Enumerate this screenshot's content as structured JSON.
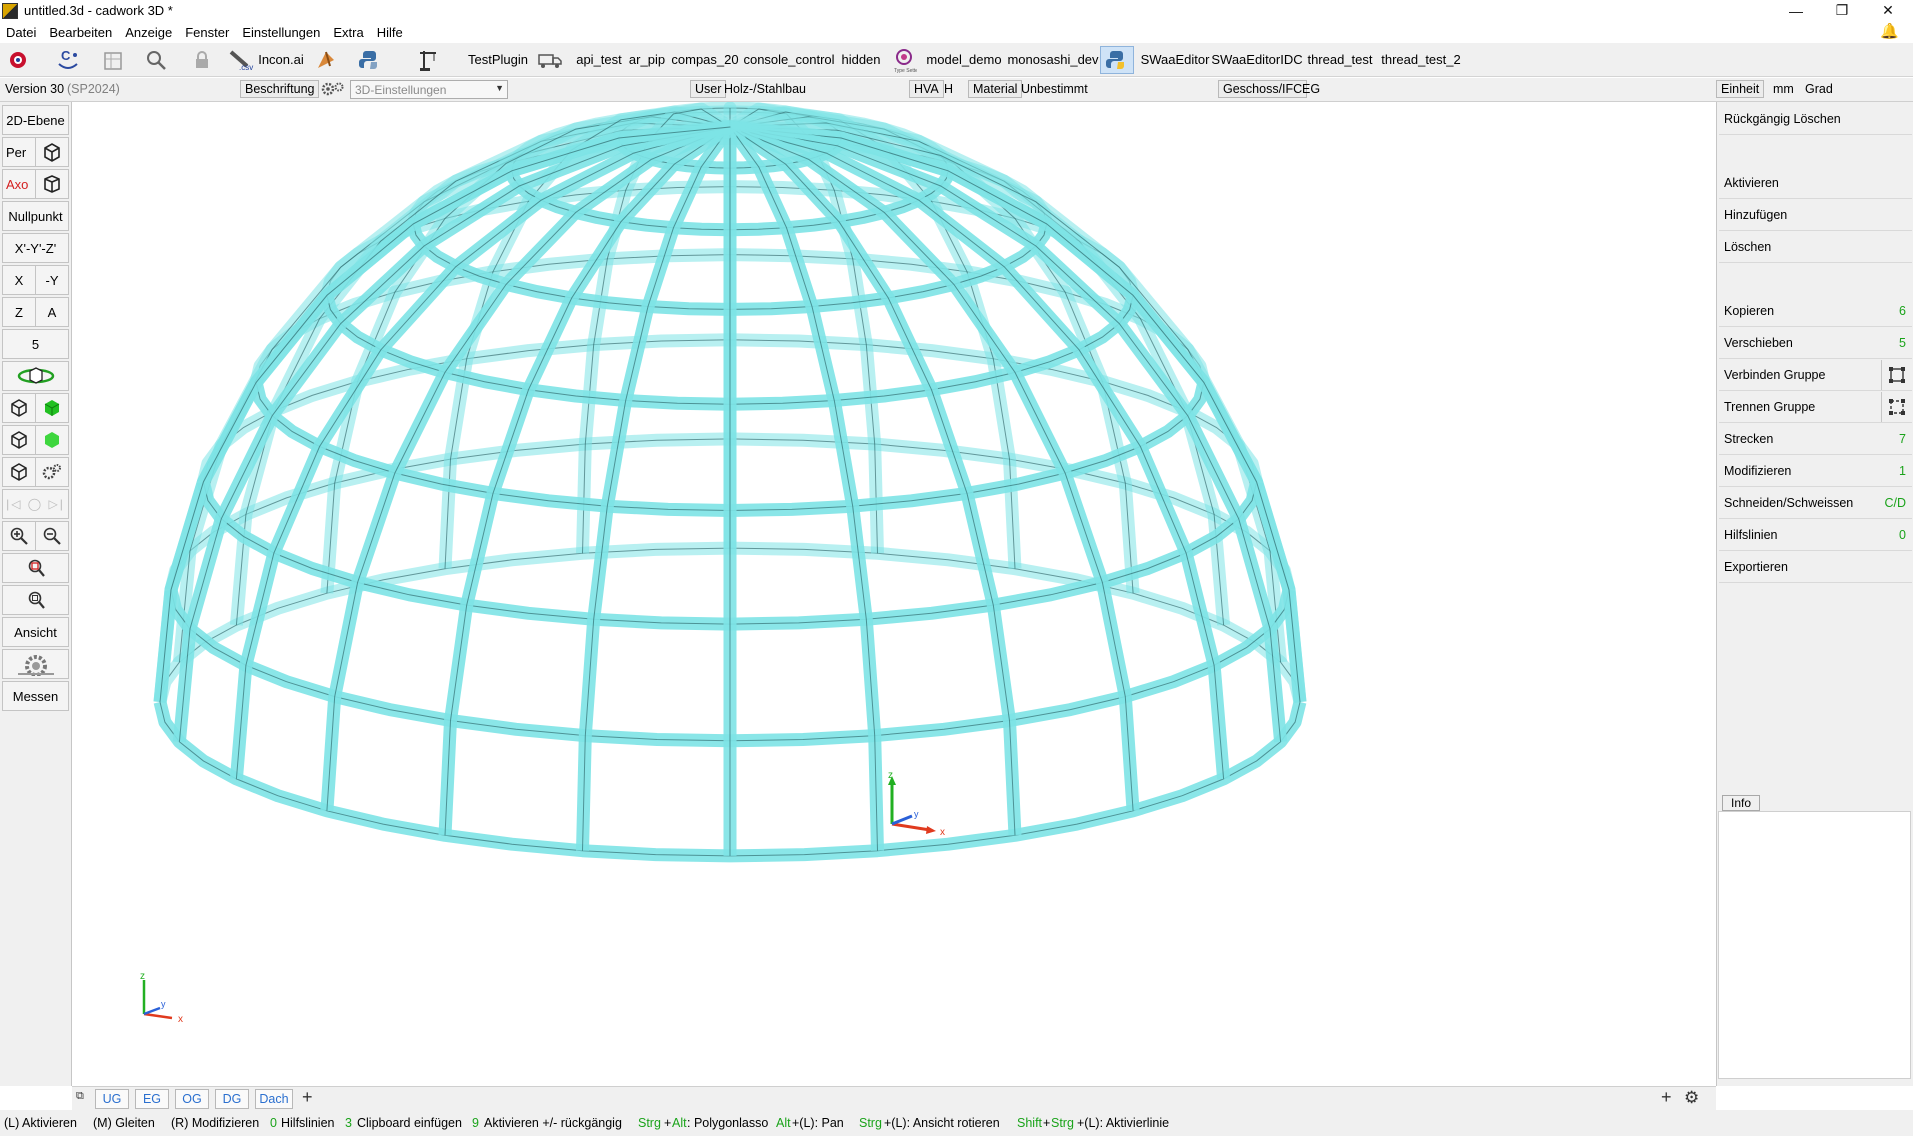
{
  "window": {
    "title": "untitled.3d - cadwork 3D *"
  },
  "menu": [
    "Datei",
    "Bearbeiten",
    "Anzeige",
    "Fenster",
    "Einstellungen",
    "Extra",
    "Hilfe"
  ],
  "toolbar": {
    "incon": "Incon.ai",
    "testplugin": "TestPlugin",
    "plugins": [
      "api_test",
      "ar_pip",
      "compas_20",
      "console_control",
      "hidden"
    ],
    "model_demo": "model_demo",
    "monosashi_dev": "monosashi_dev",
    "swaa_editor": "SWaaEditor",
    "swaa_editor_idc": "SWaaEditorIDC",
    "thread_test": "thread_test",
    "thread_test_2": "thread_test_2"
  },
  "infobar": {
    "version": "Version 30",
    "sp": "(SP2024)",
    "beschriftung": "Beschriftung",
    "settings3d": "3D-Einstellungen",
    "user_label": "User",
    "user_value": "Holz-/Stahlbau",
    "hva_label": "HVA",
    "hva_value": "H",
    "material_label": "Material",
    "material_value": "Unbestimmt",
    "geschoss_label": "Geschoss/IFC",
    "geschoss_value": "EG",
    "einheit_label": "Einheit",
    "unit_length": "mm",
    "unit_angle": "Grad"
  },
  "left_toolbar": {
    "ebene": "2D-Ebene",
    "per": "Per",
    "axo": "Axo",
    "nullpunkt": "Nullpunkt",
    "xyz": "X'-Y'-Z'",
    "x": "X",
    "neg_y": "-Y",
    "z": "Z",
    "a": "A",
    "five": "5",
    "ansicht": "Ansicht",
    "messen": "Messen"
  },
  "right_panel": {
    "undo_delete": "Rückgängig Löschen",
    "items": [
      {
        "label": "Aktivieren",
        "shortcut": ""
      },
      {
        "label": "Hinzufügen",
        "shortcut": ""
      },
      {
        "label": "Löschen",
        "shortcut": ""
      },
      {
        "label": "Kopieren",
        "shortcut": "6"
      },
      {
        "label": "Verschieben",
        "shortcut": "5"
      },
      {
        "label": "Verbinden Gruppe",
        "shortcut": ""
      },
      {
        "label": "Trennen Gruppe",
        "shortcut": ""
      },
      {
        "label": "Strecken",
        "shortcut": "7"
      },
      {
        "label": "Modifizieren",
        "shortcut": "1"
      },
      {
        "label": "Schneiden/Schweissen",
        "shortcut": "C/D"
      },
      {
        "label": "Hilfslinien",
        "shortcut": "0"
      },
      {
        "label": "Exportieren",
        "shortcut": ""
      }
    ],
    "info_tab": "Info"
  },
  "axis": {
    "x": "x",
    "y": "y",
    "z": "z"
  },
  "floor_tabs": [
    "UG",
    "EG",
    "OG",
    "DG",
    "Dach"
  ],
  "statusline": {
    "l_key": "(L) Aktivieren",
    "m_key": "(M) Gleiten",
    "r_key": "(R) Modifizieren",
    "k0": "0",
    "k0_text": "Hilfslinien",
    "k3": "3",
    "k3_text": "Clipboard einfügen",
    "k9": "9",
    "k9_text": "Aktivieren +/- rückgängig",
    "strg_alt_1": "Strg",
    "strg_alt_plus": "+",
    "strg_alt_2": "Alt",
    "strg_alt_text": ": Polygonlasso",
    "alt_l_1": "Alt",
    "alt_l_text": "+(L): Pan",
    "strg_l_1": "Strg",
    "strg_l_text": "+(L): Ansicht rotieren",
    "shift_1": "Shift",
    "shift_plus": "+",
    "shift_2": "Strg",
    "shift_text": "+(L): Aktivierlinie"
  },
  "colors": {
    "dome_fill": "#7de3e6",
    "dome_stroke": "#1c4f52",
    "axis_x": "#e03a1e",
    "axis_y": "#2a60d8",
    "axis_z": "#22b022",
    "shortcut": "#1aa31a",
    "tab_text": "#2a6fcf"
  }
}
